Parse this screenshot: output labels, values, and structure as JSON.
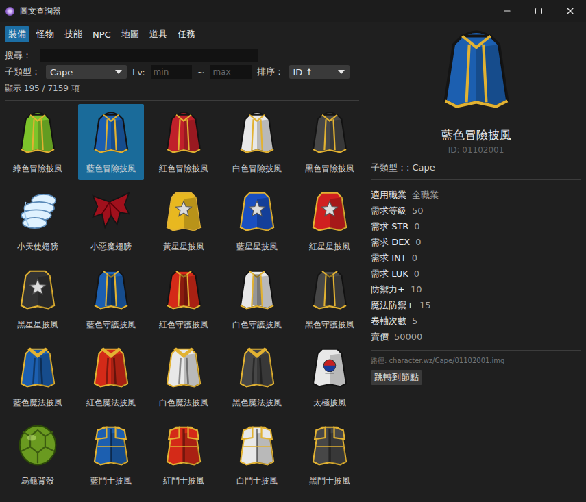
{
  "window": {
    "title": "圖文查詢器"
  },
  "tabs": [
    {
      "label": "裝備",
      "selected": true
    },
    {
      "label": "怪物",
      "selected": false
    },
    {
      "label": "技能",
      "selected": false
    },
    {
      "label": "NPC",
      "selected": false
    },
    {
      "label": "地圖",
      "selected": false
    },
    {
      "label": "道具",
      "selected": false
    },
    {
      "label": "任務",
      "selected": false
    }
  ],
  "search": {
    "label": "搜尋：",
    "value": ""
  },
  "filters": {
    "subtype_label": "子類型：",
    "subtype": "Cape",
    "lv_label": "Lv:",
    "min_placeholder": "min",
    "range_separator": "~",
    "max_placeholder": "max",
    "sort_label": "排序：",
    "sort": "ID ↑"
  },
  "count": "顯示 195 / 7159 項",
  "items": [
    {
      "name": "綠色冒險披風",
      "kind": "adventure",
      "color": "#7cc42a",
      "selected": false
    },
    {
      "name": "藍色冒險披風",
      "kind": "adventure",
      "color": "#1c5fb0",
      "selected": true
    },
    {
      "name": "紅色冒險披風",
      "kind": "adventure",
      "color": "#c0202a",
      "selected": false
    },
    {
      "name": "白色冒險披風",
      "kind": "adventure",
      "color": "#e8e8e8",
      "selected": false
    },
    {
      "name": "黑色冒險披風",
      "kind": "adventure",
      "color": "#474747",
      "selected": false
    },
    {
      "name": "小天使翅膀",
      "kind": "angel",
      "color": "#dff2ff",
      "selected": false
    },
    {
      "name": "小惡魔翅膀",
      "kind": "devil",
      "color": "#a0101c",
      "selected": false
    },
    {
      "name": "黃星星披風",
      "kind": "star",
      "color": "#e8b820",
      "selected": false
    },
    {
      "name": "藍星星披風",
      "kind": "star",
      "color": "#1a4fc0",
      "selected": false
    },
    {
      "name": "紅星星披風",
      "kind": "star",
      "color": "#d02020",
      "selected": false
    },
    {
      "name": "黑星星披風",
      "kind": "star",
      "color": "#333333",
      "selected": false
    },
    {
      "name": "藍色守護披風",
      "kind": "guard",
      "color": "#1c5fb0",
      "selected": false
    },
    {
      "name": "紅色守護披風",
      "kind": "guard",
      "color": "#d42a18",
      "selected": false
    },
    {
      "name": "白色守護披風",
      "kind": "guard",
      "color": "#e8e8e8",
      "selected": false
    },
    {
      "name": "黑色守護披風",
      "kind": "guard",
      "color": "#474747",
      "selected": false
    },
    {
      "name": "藍色魔法披風",
      "kind": "magic",
      "color": "#1c5fb0",
      "selected": false
    },
    {
      "name": "紅色魔法披風",
      "kind": "magic",
      "color": "#d42a18",
      "selected": false
    },
    {
      "name": "白色魔法披風",
      "kind": "magic",
      "color": "#e8e8e8",
      "selected": false
    },
    {
      "name": "黑色魔法披風",
      "kind": "magic",
      "color": "#474747",
      "selected": false
    },
    {
      "name": "太極披風",
      "kind": "taiji",
      "color": "#e8e8e8",
      "selected": false
    },
    {
      "name": "烏龜背殼",
      "kind": "shell",
      "color": "#6a9a20",
      "selected": false
    },
    {
      "name": "藍鬥士披風",
      "kind": "fighter",
      "color": "#1c5fb0",
      "selected": false
    },
    {
      "name": "紅鬥士披風",
      "kind": "fighter",
      "color": "#d42a18",
      "selected": false
    },
    {
      "name": "白鬥士披風",
      "kind": "fighter",
      "color": "#e8e8e8",
      "selected": false
    },
    {
      "name": "黑鬥士披風",
      "kind": "fighter",
      "color": "#474747",
      "selected": false
    }
  ],
  "detail": {
    "name": "藍色冒險披風",
    "id": "ID: 01102001",
    "kind": "adventure",
    "color": "#1c5fb0",
    "subtype": "子類型：: Cape",
    "stats": [
      {
        "label": "適用職業",
        "value": "全職業"
      },
      {
        "label": "需求等級",
        "value": "50"
      },
      {
        "label": "需求 STR",
        "value": "0"
      },
      {
        "label": "需求 DEX",
        "value": "0"
      },
      {
        "label": "需求 INT",
        "value": "0"
      },
      {
        "label": "需求 LUK",
        "value": "0"
      },
      {
        "label": "防禦力+",
        "value": "10"
      },
      {
        "label": "魔法防禦+",
        "value": "15"
      },
      {
        "label": "卷軸次數",
        "value": "5"
      },
      {
        "label": "賣價",
        "value": "50000"
      }
    ],
    "path": "路徑: character.wz/Cape/01102001.img",
    "button": "跳轉到節點"
  }
}
